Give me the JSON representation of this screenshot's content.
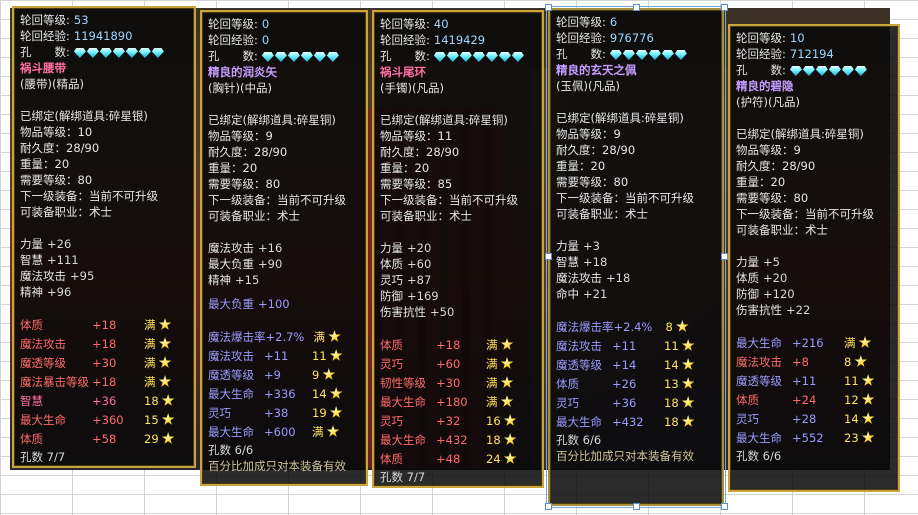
{
  "panels": [
    {
      "lunhui_level_label": "轮回等级:",
      "lunhui_level": "53",
      "lunhui_exp_label": "轮回经验:",
      "lunhui_exp": "11941890",
      "holes_label": "孔　　数:",
      "item_name": "祸斗腰带",
      "item_type": "(腰带)(精品)",
      "bound": "已绑定(解绑道具:碎星银)",
      "item_level": "物品等级：10",
      "durability": "耐久度：28/90",
      "weight": "重量：20",
      "req_level": "需要等级：80",
      "next_equip": "下一级装备：当前不可升级",
      "job": "可装备职业：术士",
      "base": [
        {
          "label": "力量",
          "val": "+26"
        },
        {
          "label": "智慧",
          "val": "+111"
        },
        {
          "label": "魔法攻击",
          "val": "+95"
        },
        {
          "label": "精神",
          "val": "+96"
        }
      ],
      "effects": [
        {
          "label": "体质",
          "val": "+18",
          "lvl": "满"
        },
        {
          "label": "魔法攻击",
          "val": "+18",
          "lvl": "满"
        },
        {
          "label": "魔透等级",
          "val": "+30",
          "lvl": "满"
        },
        {
          "label": "魔法暴击等级",
          "val": "+18",
          "lvl": "满"
        },
        {
          "label": "智慧",
          "val": "+36",
          "lvl": "18"
        },
        {
          "label": "最大生命",
          "val": "+360",
          "lvl": "15"
        },
        {
          "label": "体质",
          "val": "+58",
          "lvl": "29"
        }
      ],
      "holes_count": "孔数 7/7"
    },
    {
      "lunhui_level_label": "轮回等级:",
      "lunhui_level": "0",
      "lunhui_exp_label": "轮回经验:",
      "lunhui_exp": "0",
      "holes_label": "孔　　数:",
      "item_name": "精良的润炎矢",
      "item_type": "(胸针)(中品)",
      "bound": "已绑定(解绑道具:碎星铜)",
      "item_level": "物品等级：9",
      "durability": "耐久度：28/90",
      "weight": "重量：20",
      "req_level": "需要等级：80",
      "next_equip": "下一级装备：当前不可升级",
      "job": "可装备职业：术士",
      "base": [
        {
          "label": "魔法攻击",
          "val": "+16"
        },
        {
          "label": "最大负重",
          "val": "+90"
        },
        {
          "label": "精神",
          "val": "+15"
        }
      ],
      "extra": {
        "label": "最大负重",
        "val": "+100"
      },
      "effects": [
        {
          "label": "魔法爆击率",
          "val": "+2.7%",
          "lvl": "满"
        },
        {
          "label": "魔法攻击",
          "val": "+11",
          "lvl": "11"
        },
        {
          "label": "魔透等级",
          "val": "+9",
          "lvl": "9"
        },
        {
          "label": "最大生命",
          "val": "+336",
          "lvl": "14"
        },
        {
          "label": "灵巧",
          "val": "+38",
          "lvl": "19"
        },
        {
          "label": "最大生命",
          "val": "+600",
          "lvl": "满"
        }
      ],
      "holes_count": "孔数 6/6",
      "footer": "百分比加成只对本装备有效"
    },
    {
      "lunhui_level_label": "轮回等级:",
      "lunhui_level": "40",
      "lunhui_exp_label": "轮回经验:",
      "lunhui_exp": "1419429",
      "holes_label": "孔　　数:",
      "item_name": "祸斗尾环",
      "item_type": "(手镯)(凡品)",
      "bound": "已绑定(解绑道具:碎星铜)",
      "item_level": "物品等级：11",
      "durability": "耐久度：28/90",
      "weight": "重量：20",
      "req_level": "需要等级：85",
      "next_equip": "下一级装备：当前不可升级",
      "job": "可装备职业：术士",
      "base": [
        {
          "label": "力量",
          "val": "+20"
        },
        {
          "label": "体质",
          "val": "+60"
        },
        {
          "label": "灵巧",
          "val": "+87"
        },
        {
          "label": "防御",
          "val": "+169"
        },
        {
          "label": "伤害抗性",
          "val": "+50"
        }
      ],
      "effects": [
        {
          "label": "体质",
          "val": "+18",
          "lvl": "满"
        },
        {
          "label": "灵巧",
          "val": "+60",
          "lvl": "满"
        },
        {
          "label": "韧性等级",
          "val": "+30",
          "lvl": "满"
        },
        {
          "label": "最大生命",
          "val": "+180",
          "lvl": "满"
        },
        {
          "label": "灵巧",
          "val": "+32",
          "lvl": "16"
        },
        {
          "label": "最大生命",
          "val": "+432",
          "lvl": "18"
        },
        {
          "label": "体质",
          "val": "+48",
          "lvl": "24"
        }
      ],
      "holes_count": "孔数 7/7"
    },
    {
      "lunhui_level_label": "轮回等级:",
      "lunhui_level": "6",
      "lunhui_exp_label": "轮回经验:",
      "lunhui_exp": "976776",
      "holes_label": "孔　　数:",
      "item_name": "精良的玄天之佩",
      "item_type": "(玉佩)(凡品)",
      "bound": "已绑定(解绑道具:碎星铜)",
      "item_level": "物品等级：9",
      "durability": "耐久度：28/90",
      "weight": "重量：20",
      "req_level": "需要等级：80",
      "next_equip": "下一级装备：当前不可升级",
      "job": "可装备职业：术士",
      "base": [
        {
          "label": "力量",
          "val": "+3"
        },
        {
          "label": "智慧",
          "val": "+18"
        },
        {
          "label": "魔法攻击",
          "val": "+18"
        },
        {
          "label": "命中",
          "val": "+21"
        }
      ],
      "effects": [
        {
          "label": "魔法爆击率",
          "val": "+2.4%",
          "lvl": "8"
        },
        {
          "label": "魔法攻击",
          "val": "+11",
          "lvl": "11"
        },
        {
          "label": "魔透等级",
          "val": "+14",
          "lvl": "14"
        },
        {
          "label": "体质",
          "val": "+26",
          "lvl": "13"
        },
        {
          "label": "灵巧",
          "val": "+36",
          "lvl": "18"
        },
        {
          "label": "最大生命",
          "val": "+432",
          "lvl": "18"
        }
      ],
      "holes_count": "孔数 6/6",
      "footer": "百分比加成只对本装备有效"
    },
    {
      "lunhui_level_label": "轮回等级:",
      "lunhui_level": "10",
      "lunhui_exp_label": "轮回经验:",
      "lunhui_exp": "712194",
      "holes_label": "孔　　数:",
      "item_name": "精良的碧隐",
      "item_type": "(护符)(凡品)",
      "bound": "已绑定(解绑道具:碎星铜)",
      "item_level": "物品等级：9",
      "durability": "耐久度：28/90",
      "weight": "重量：20",
      "req_level": "需要等级：80",
      "next_equip": "下一级装备：当前不可升级",
      "job": "可装备职业：术士",
      "base": [
        {
          "label": "力量",
          "val": "+5"
        },
        {
          "label": "体质",
          "val": "+20"
        },
        {
          "label": "防御",
          "val": "+120"
        },
        {
          "label": "伤害抗性",
          "val": "+22"
        }
      ],
      "effects": [
        {
          "label": "最大生命",
          "val": "+216",
          "lvl": "满"
        },
        {
          "label": "魔法攻击",
          "val": "+8",
          "lvl": "8"
        },
        {
          "label": "魔透等级",
          "val": "+11",
          "lvl": "11"
        },
        {
          "label": "体质",
          "val": "+24",
          "lvl": "12"
        },
        {
          "label": "灵巧",
          "val": "+28",
          "lvl": "14"
        },
        {
          "label": "最大生命",
          "val": "+552",
          "lvl": "23"
        }
      ],
      "holes_count": "孔数 6/6"
    }
  ],
  "colors": {
    "border": "#c9a43a",
    "name_pink": "#ff6fa3",
    "name_purple": "#c79bff",
    "effect_red": "#ff6a6a",
    "effect_blue": "#9b9bff",
    "level_yellow": "#ffe45c",
    "gem": "#6ef0ff"
  },
  "icons": {
    "gem": "diamond-icon",
    "level": "star-icon"
  }
}
